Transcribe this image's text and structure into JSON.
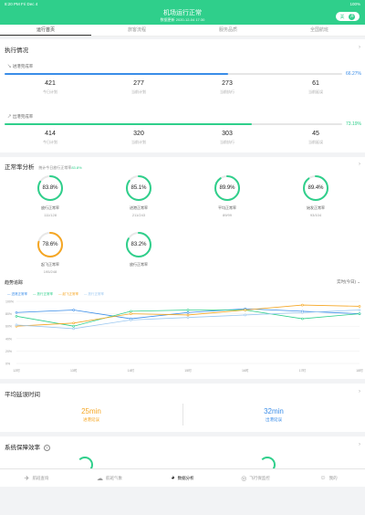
{
  "status": {
    "time": "8:20 PM",
    "date": "Fri Dec 4",
    "battery": "100%"
  },
  "header": {
    "title": "机场运行正常",
    "subtitle": "数据更新 2020-12-04 17:30",
    "toggle_label": "关",
    "toggle_dot": "开"
  },
  "tabs": [
    "运行首页",
    "旅客流程",
    "服务品质",
    "全国航班"
  ],
  "execution": {
    "title": "执行情况",
    "departure": {
      "label": "进港完成率",
      "pct": 0.6627,
      "pct_text": "66.27%",
      "stats": [
        {
          "value": "421",
          "label": "今日计划"
        },
        {
          "value": "277",
          "label": "当前计划"
        },
        {
          "value": "273",
          "label": "当前执行"
        },
        {
          "value": "61",
          "label": "当前延误"
        }
      ]
    },
    "arrival": {
      "label": "出港完成率",
      "pct": 0.7319,
      "pct_text": "73.19%",
      "stats": [
        {
          "value": "414",
          "label": "今日计划"
        },
        {
          "value": "320",
          "label": "当前计划"
        },
        {
          "value": "303",
          "label": "当前执行"
        },
        {
          "value": "45",
          "label": "当前延误"
        }
      ]
    }
  },
  "punctuality": {
    "title": "正常率分析",
    "note_prefix": "统计今日放行正常率",
    "note_value": "83.8%",
    "rings": [
      {
        "value": "83.8%",
        "name": "放行正常率",
        "frac": "111/128",
        "pct": 0.838,
        "color": "#2fcf8b"
      },
      {
        "value": "85.1%",
        "name": "进港正常率",
        "frac": "211/243",
        "pct": 0.851,
        "color": "#2fcf8b"
      },
      {
        "value": "89.9%",
        "name": "平均正常率",
        "frac": "89/99",
        "pct": 0.899,
        "color": "#2fcf8b"
      },
      {
        "value": "89.4%",
        "name": "始发正常率",
        "frac": "93/104",
        "pct": 0.894,
        "color": "#2fcf8b"
      },
      {
        "value": "78.6%",
        "name": "起飞正常率",
        "frac": "195/248",
        "pct": 0.786,
        "color": "#f5a623"
      },
      {
        "value": "83.2%",
        "name": "放行正常率",
        "frac": "",
        "pct": 0.832,
        "color": "#2fcf8b"
      }
    ]
  },
  "trend": {
    "title": "趋势追踪",
    "filter": "实时(今日)",
    "legend": [
      "进港正常率",
      "放行正常率",
      "起飞正常率",
      "放行正常率"
    ]
  },
  "chart_data": {
    "type": "line",
    "x": [
      "12时",
      "13时",
      "14时",
      "15时",
      "16时",
      "17时",
      "18时"
    ],
    "yticks": [
      "100%",
      "80%",
      "60%",
      "40%",
      "20%",
      "0%"
    ],
    "ylim": [
      0,
      100
    ],
    "series": [
      {
        "name": "进港正常率",
        "color": "#3a8de8",
        "values": [
          82,
          86,
          72,
          82,
          88,
          84,
          80
        ]
      },
      {
        "name": "放行正常率",
        "color": "#2fcf8b",
        "values": [
          76,
          60,
          84,
          86,
          86,
          72,
          80
        ]
      },
      {
        "name": "起飞正常率",
        "color": "#f5a623",
        "values": [
          60,
          65,
          80,
          78,
          86,
          94,
          92
        ]
      },
      {
        "name": "放行正常率",
        "color": "#9cc8f0",
        "values": [
          62,
          56,
          70,
          74,
          78,
          82,
          86
        ]
      }
    ]
  },
  "waiting": {
    "title": "平均延误时间",
    "left_value": "25min",
    "left_label": "进港延误",
    "right_value": "32min",
    "right_label": "出港延误"
  },
  "efficiency": {
    "title": "系统保障效率",
    "help": "?"
  },
  "nav": [
    {
      "label": "航班查询",
      "icon": "✈"
    },
    {
      "label": "航班气象",
      "icon": "☁"
    },
    {
      "label": "数据分析",
      "icon": "◕"
    },
    {
      "label": "飞行保监控",
      "icon": "◎"
    },
    {
      "label": "我的",
      "icon": "☺"
    }
  ]
}
